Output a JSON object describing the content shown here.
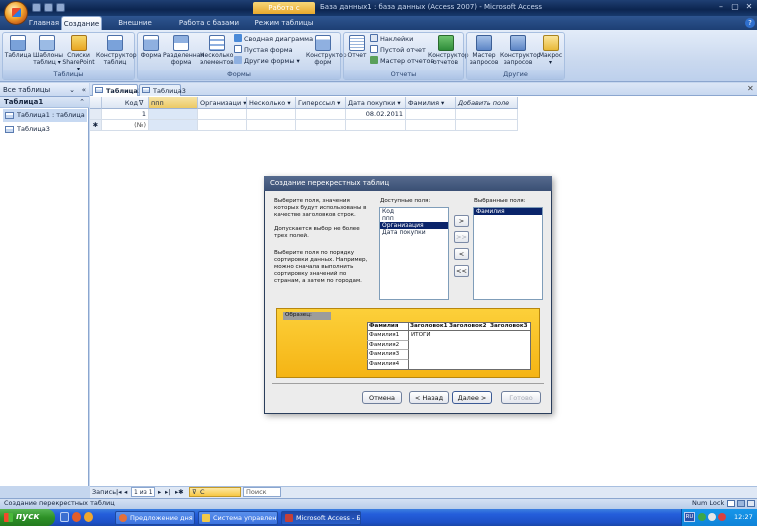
{
  "window": {
    "title": "База данных1 : база данных (Access 2007) - Microsoft Access",
    "context_tab": "Работа с таблицами",
    "minimize": "–",
    "maximize": "▢",
    "close": "✕"
  },
  "tabs": [
    "Главная",
    "Создание",
    "Внешние данные",
    "Работа с базами данных",
    "Режим таблицы"
  ],
  "active_tab": "Создание",
  "ribbon": {
    "groups": [
      {
        "label": "Таблицы",
        "buttons": [
          "Таблица",
          "Шаблоны таблиц ▾",
          "Списки SharePoint ▾",
          "Конструктор таблиц"
        ]
      },
      {
        "label": "Формы",
        "buttons": [
          "Форма",
          "Разделенная форма",
          "Несколько элементов"
        ],
        "small": [
          "Сводная диаграмма",
          "Пустая форма",
          "Другие формы ▾"
        ],
        "extra": "Конструктор форм"
      },
      {
        "label": "Отчеты",
        "buttons": [
          "Отчет"
        ],
        "small": [
          "Наклейки",
          "Пустой отчет",
          "Мастер отчетов"
        ],
        "extra": "Конструктор отчетов"
      },
      {
        "label": "Другие",
        "buttons": [
          "Мастер запросов",
          "Конструктор запросов",
          "Макрос ▾"
        ]
      }
    ]
  },
  "nav": {
    "header": "Все таблицы",
    "group": "Таблица1",
    "items": [
      "Таблица1 : таблица",
      "Таблица3"
    ]
  },
  "doc_tabs": [
    "Таблица1",
    "Таблица3"
  ],
  "grid": {
    "columns": [
      "Код",
      "ппп",
      "Организаци ▾",
      "Несколько ▾",
      "Гиперссыл ▾",
      "Дата покупки ▾",
      "Фамилия ▾",
      "Добавить поле"
    ],
    "rows": [
      [
        "1",
        "",
        "",
        "",
        "",
        "08.02.2011",
        "",
        ""
      ]
    ],
    "new_row_marker": "✱",
    "new_row_code": "(№)"
  },
  "record_nav": {
    "label": "Запись:",
    "position": "1 из 1",
    "filter": "С фильтром",
    "search": "Поиск"
  },
  "status": {
    "text": "Создание перекрестных таблиц",
    "numlock": "Num Lock"
  },
  "dialog": {
    "title": "Создание перекрестных таблиц",
    "instructions": [
      "Выберите поля, значения которых будут использованы в качестве заголовков строк.",
      "Допускается выбор не более трех полей.",
      "Выберите поля по порядку сортировки данных. Например, можно сначала выполнить сортировку значений по странам, а затем по городам."
    ],
    "available_label": "Доступные поля:",
    "available": [
      "Код",
      "ппп",
      "Организация",
      "Дата покупки"
    ],
    "available_selected": "Организация",
    "selected_label": "Выбранные поля:",
    "selected": [
      "Фамилия"
    ],
    "move_buttons": [
      ">",
      ">>",
      "<",
      "<<"
    ],
    "sample_label": "Образец:",
    "sample_header": [
      "Фамилия",
      "Заголовок1",
      "Заголовок2",
      "Заголовок3"
    ],
    "sample_rows": [
      "Фамилия1",
      "Фамилия2",
      "Фамилия3",
      "Фамилия4"
    ],
    "sample_total": "ИТОГИ",
    "buttons": {
      "cancel": "Отмена",
      "back": "< Назад",
      "next": "Далее >",
      "finish": "Готово"
    }
  },
  "taskbar": {
    "start": "пуск",
    "items": [
      "Предложение дня - ...",
      "Система управлени...",
      "Microsoft Access - Ба..."
    ],
    "clock": "12:27",
    "lang": "RU"
  }
}
